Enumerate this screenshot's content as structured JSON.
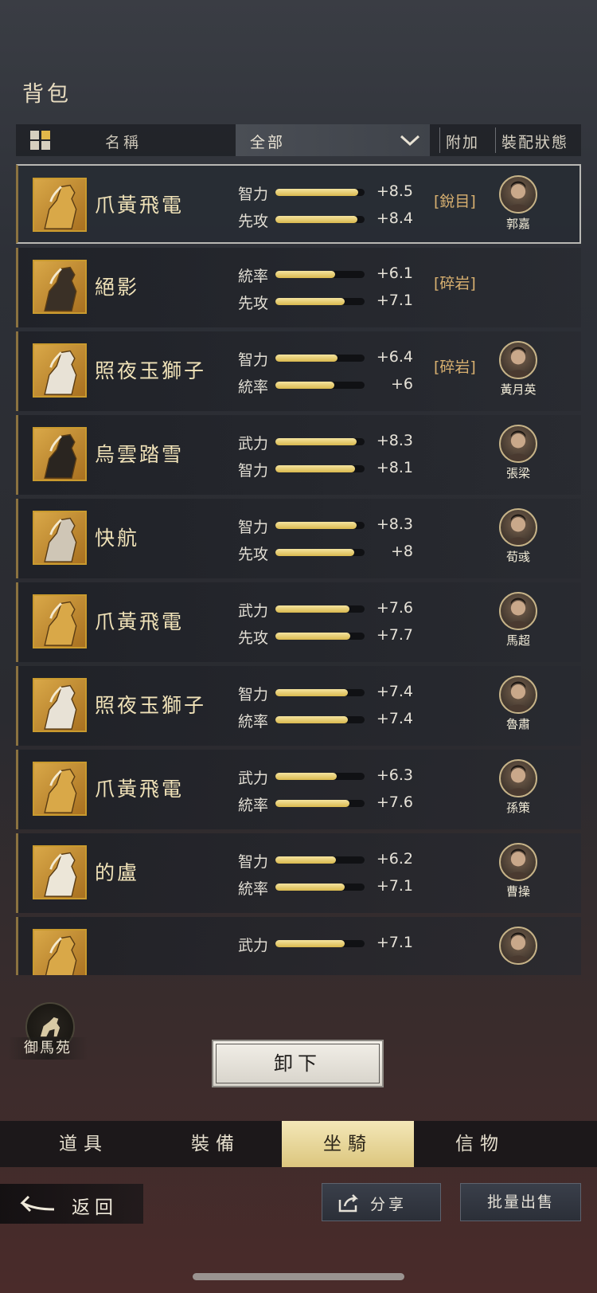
{
  "page_title": "背包",
  "header": {
    "name_label": "名稱",
    "filter_value": "全部",
    "extra_label": "附加",
    "status_label": "裝配狀態"
  },
  "rows": [
    {
      "name": "爪黃飛電",
      "stats": [
        {
          "label": "智力",
          "value": "+8.5",
          "fill": 0.93
        },
        {
          "label": "先攻",
          "value": "+8.4",
          "fill": 0.92
        }
      ],
      "skill": "[銳目]",
      "general": "郭嘉",
      "selected": true
    },
    {
      "name": "絕影",
      "stats": [
        {
          "label": "統率",
          "value": "+6.1",
          "fill": 0.67
        },
        {
          "label": "先攻",
          "value": "+7.1",
          "fill": 0.78
        }
      ],
      "skill": "[碎岩]",
      "general": ""
    },
    {
      "name": "照夜玉獅子",
      "stats": [
        {
          "label": "智力",
          "value": "+6.4",
          "fill": 0.7
        },
        {
          "label": "統率",
          "value": "+6",
          "fill": 0.66
        }
      ],
      "skill": "[碎岩]",
      "general": "黃月英"
    },
    {
      "name": "烏雲踏雪",
      "stats": [
        {
          "label": "武力",
          "value": "+8.3",
          "fill": 0.91
        },
        {
          "label": "智力",
          "value": "+8.1",
          "fill": 0.89
        }
      ],
      "skill": "",
      "general": "張梁"
    },
    {
      "name": "快航",
      "stats": [
        {
          "label": "智力",
          "value": "+8.3",
          "fill": 0.91
        },
        {
          "label": "先攻",
          "value": "+8",
          "fill": 0.88
        }
      ],
      "skill": "",
      "general": "荀彧"
    },
    {
      "name": "爪黃飛電",
      "stats": [
        {
          "label": "武力",
          "value": "+7.6",
          "fill": 0.83
        },
        {
          "label": "先攻",
          "value": "+7.7",
          "fill": 0.84
        }
      ],
      "skill": "",
      "general": "馬超"
    },
    {
      "name": "照夜玉獅子",
      "stats": [
        {
          "label": "智力",
          "value": "+7.4",
          "fill": 0.81
        },
        {
          "label": "統率",
          "value": "+7.4",
          "fill": 0.81
        }
      ],
      "skill": "",
      "general": "魯肅"
    },
    {
      "name": "爪黃飛電",
      "stats": [
        {
          "label": "武力",
          "value": "+6.3",
          "fill": 0.69
        },
        {
          "label": "統率",
          "value": "+7.6",
          "fill": 0.83
        }
      ],
      "skill": "",
      "general": "孫策"
    },
    {
      "name": "的盧",
      "stats": [
        {
          "label": "智力",
          "value": "+6.2",
          "fill": 0.68
        },
        {
          "label": "統率",
          "value": "+7.1",
          "fill": 0.78
        }
      ],
      "skill": "",
      "general": "曹操"
    },
    {
      "name": "",
      "stats": [
        {
          "label": "武力",
          "value": "+7.1",
          "fill": 0.78
        },
        {
          "label": "",
          "value": "",
          "fill": 0
        }
      ],
      "skill": "",
      "general": ""
    }
  ],
  "stable_label": "御馬苑",
  "unequip_label": "卸下",
  "tabs": [
    {
      "label": "道具",
      "active": false
    },
    {
      "label": "裝備",
      "active": false
    },
    {
      "label": "坐騎",
      "active": true
    },
    {
      "label": "信物",
      "active": false
    }
  ],
  "back_label": "返回",
  "share_label": "分享",
  "bulk_sell_label": "批量出售",
  "colors": {
    "accent_gold": "#d9b94e",
    "skill_orange": "#d8b070"
  }
}
